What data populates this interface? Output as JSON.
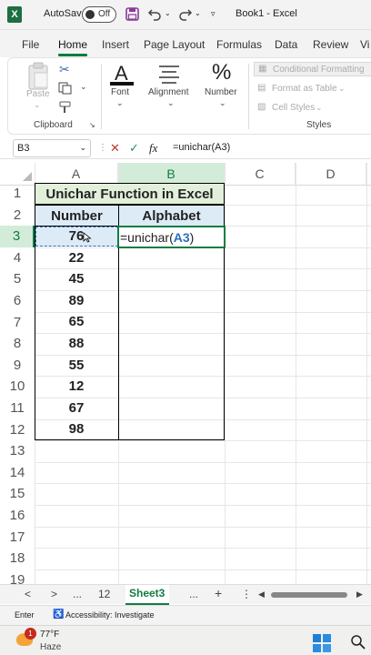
{
  "titlebar": {
    "autosave_label": "AutoSave",
    "autosave_state": "Off",
    "book_title": "Book1 - Excel",
    "icons": [
      "excel-logo-icon",
      "save-icon",
      "undo-icon",
      "redo-icon",
      "customize-qat-icon"
    ]
  },
  "menu": {
    "tabs": [
      "File",
      "Home",
      "Insert",
      "Page Layout",
      "Formulas",
      "Data",
      "Review",
      "Vi"
    ],
    "active": "Home"
  },
  "ribbon": {
    "clipboard": {
      "paste": "Paste",
      "group": "Clipboard"
    },
    "font": "Font",
    "alignment": "Alignment",
    "number": "Number",
    "styles": {
      "conditional_formatting": "Conditional Formatting",
      "format_as_table": "Format as Table",
      "cell_styles": "Cell Styles",
      "group": "Styles"
    }
  },
  "formula_bar": {
    "name_box": "B3",
    "fx": "fx",
    "formula": "=unichar(A3)"
  },
  "grid": {
    "columns": [
      "A",
      "B",
      "C",
      "D"
    ],
    "selected_column": "B",
    "rows": [
      "1",
      "2",
      "3",
      "4",
      "5",
      "6",
      "7",
      "8",
      "9",
      "10",
      "11",
      "12",
      "13",
      "14",
      "15",
      "16",
      "17",
      "18",
      "19"
    ],
    "selected_row": "3",
    "table_title": "Unichar Function in Excel",
    "headers": {
      "number": "Number",
      "alphabet": "Alphabet"
    },
    "numbers": [
      "76",
      "22",
      "45",
      "89",
      "65",
      "88",
      "55",
      "12",
      "67",
      "98"
    ],
    "b3_edit": {
      "prefix": "=unichar(",
      "ref": "A3",
      "suffix": ")"
    },
    "colors": {
      "title_fill": "#e2efda",
      "header_fill": "#ddebf7",
      "ref_blue": "#2f6fbd",
      "selection_green": "#107c41"
    }
  },
  "sheet_tabs": {
    "prev": "<",
    "next": ">",
    "dots_left": "...",
    "tab_12": "12",
    "active": "Sheet3",
    "dots_right": "...",
    "add": "+",
    "more": "⋮"
  },
  "status_bar": {
    "mode": "Enter",
    "accessibility": "Accessibility: Investigate"
  },
  "taskbar": {
    "notification_count": "1",
    "temperature": "77°F",
    "weather": "Haze"
  }
}
